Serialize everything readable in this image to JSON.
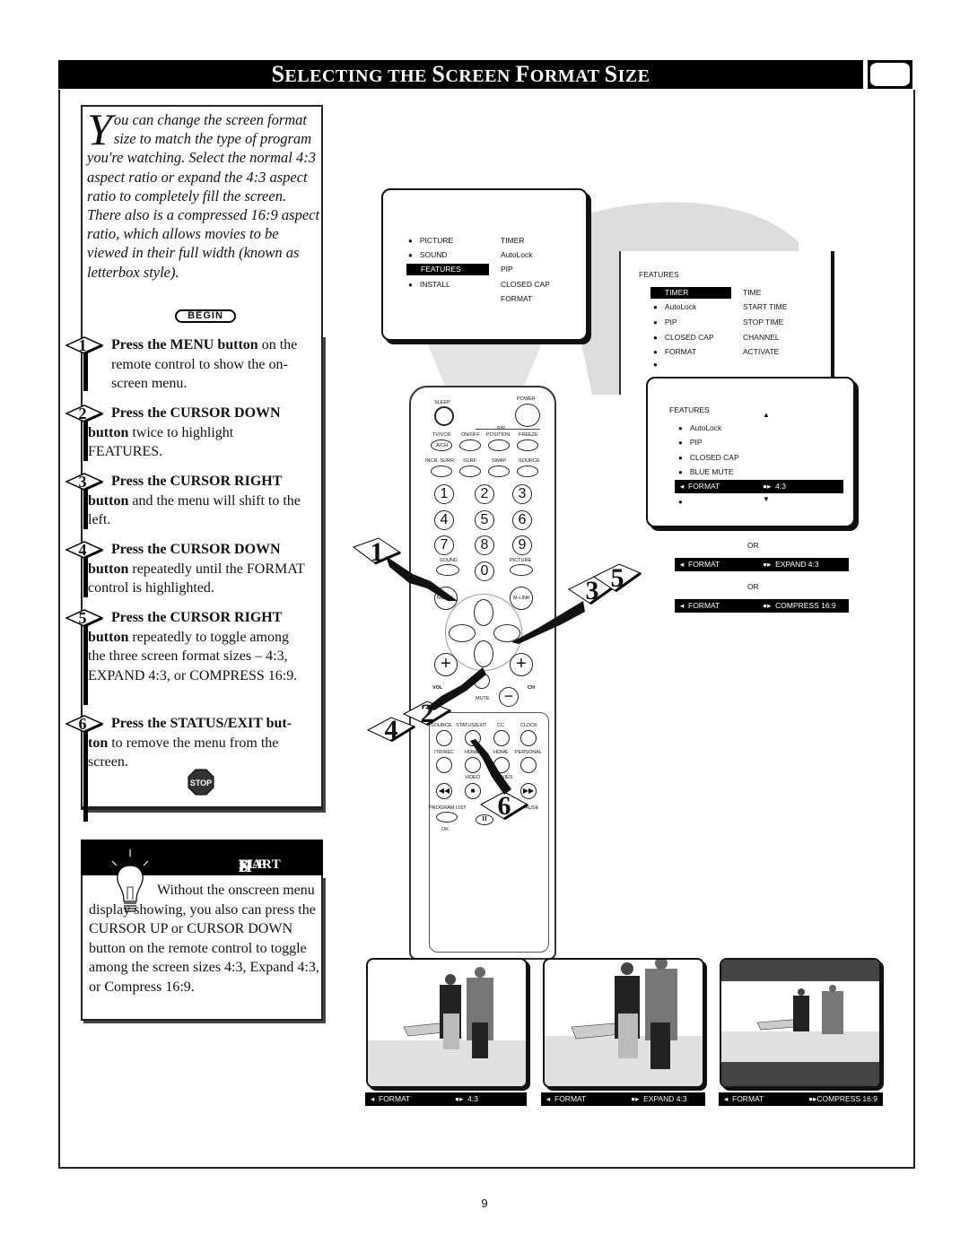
{
  "header": {
    "title_parts": [
      {
        "cap": "S",
        "rest": "ELECTING THE "
      },
      {
        "cap": "S",
        "rest": "CREEN "
      },
      {
        "cap": "F",
        "rest": "ORMAT "
      },
      {
        "cap": "S",
        "rest": "IZE"
      }
    ],
    "icon": "tv-screen-icon"
  },
  "intro": {
    "dropcap": "Y",
    "text": "ou can change the screen format size to match the type of program you're watching. Select the normal 4:3 aspect ratio or expand the 4:3 aspect ratio to completely fill the screen. There also is a compressed 16:9 aspect ratio, which allows movies to be viewed in their full width (known as letterbox style).",
    "begin_label": "BEGIN"
  },
  "steps": [
    {
      "num": "1",
      "lead": "Press the MENU button",
      "rest": " on the remote control to show the on-screen menu."
    },
    {
      "num": "2",
      "lead": "Press the CURSOR DOWN",
      "bold2": "button",
      "rest": " twice to highlight FEATURES."
    },
    {
      "num": "3",
      "lead": "Press the CURSOR RIGHT",
      "bold2": "button",
      "rest": " and the menu will shift to the left."
    },
    {
      "num": "4",
      "lead": "Press the CURSOR DOWN",
      "bold2": "button",
      "rest": " repeatedly until the FORMAT control is highlighted."
    },
    {
      "num": "5",
      "lead": "Press the CURSOR RIGHT",
      "bold2": "button",
      "rest": " repeatedly to toggle among the three screen format sizes – 4:3, EXPAND 4:3, or COMPRESS 16:9."
    },
    {
      "num": "6",
      "lead": "Press the STATUS/EXIT but-",
      "bold2": "ton",
      "rest": " to remove the menu from the screen."
    }
  ],
  "stop_label": "STOP",
  "smart_help": {
    "title_cap1": "S",
    "title_rest1": "MART ",
    "title_cap2": "H",
    "title_rest2": "ELP",
    "text": "Without the onscreen menu display showing, you also can press the CURSOR UP or CURSOR DOWN button on the remote control to toggle among the screen sizes 4:3, Expand 4:3, or Compress 16:9."
  },
  "menu1": {
    "left": [
      "PICTURE",
      "SOUND",
      "FEATURES",
      "INSTALL"
    ],
    "right": [
      "TIMER",
      "AutoLock",
      "PIP",
      "CLOSED CAP",
      "FORMAT"
    ],
    "highlighted": "FEATURES"
  },
  "menu2": {
    "title": "FEATURES",
    "left": [
      "TIMER",
      "AutoLock",
      "PIP",
      "CLOSED CAP",
      "FORMAT",
      ""
    ],
    "right": [
      "TIME",
      "START TIME",
      "STOP TIME",
      "CHANNEL",
      "ACTIVATE"
    ],
    "highlighted": "TIMER"
  },
  "menu3": {
    "title": "FEATURES",
    "items": [
      "AutoLock",
      "PIP",
      "CLOSED CAP",
      "BLUE MUTE"
    ],
    "format_label": "FORMAT",
    "format_value": "4:3",
    "up_arrow": "▲",
    "down_arrow": "▼"
  },
  "alternatives": {
    "or": "OR",
    "options": [
      {
        "label": "FORMAT",
        "value": "EXPAND 4:3"
      },
      {
        "label": "FORMAT",
        "value": "COMPRESS 16:9"
      }
    ]
  },
  "remote": {
    "top_labels": {
      "sleep": "SLEEP",
      "power": "POWER",
      "pip": "PIP",
      "tvvcr": "TV/VCR",
      "onoff": "ON/OFF",
      "position": "POSITION",
      "freeze": "FREEZE",
      "ach": "A/CH",
      "incr": "INCR. SURR.",
      "surf": "SURF",
      "swap": "SWAP",
      "source": "SOURCE"
    },
    "digits": [
      "1",
      "2",
      "3",
      "4",
      "5",
      "6",
      "7",
      "8",
      "9",
      "0"
    ],
    "sound": "SOUND",
    "picture": "PICTURE",
    "menu": "MENU",
    "mlink": "M-LINK",
    "vol": "VOL",
    "ch": "CH",
    "mute": "MUTE",
    "bottom_labels": [
      "SOURCE",
      "STATUS/EXIT",
      "CC",
      "CLOCK",
      "ITR/REC",
      "HOME",
      "HOME",
      "PERSONAL",
      "VIDEO",
      "MOVIES",
      "PROGRAM LIST",
      "PAUSE",
      "OK"
    ]
  },
  "callouts": [
    "1",
    "2",
    "3",
    "4",
    "5",
    "6"
  ],
  "bottom_screens": [
    {
      "label": "FORMAT",
      "value": "4:3"
    },
    {
      "label": "FORMAT",
      "value": "EXPAND 4:3"
    },
    {
      "label": "FORMAT",
      "value": "COMPRESS 16:9"
    }
  ],
  "page_number": "9"
}
